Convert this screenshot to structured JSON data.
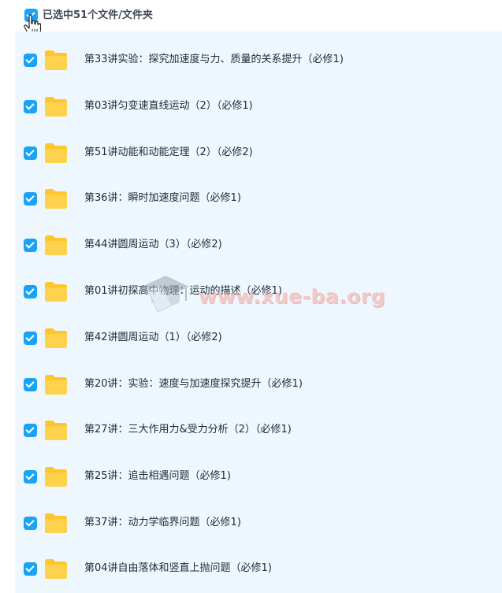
{
  "header": {
    "selection_label": "已选中51个文件/文件夹"
  },
  "items": [
    {
      "name": "第33讲实验：探究加速度与力、质量的关系提升（必修1)"
    },
    {
      "name": "第03讲匀变速直线运动（2）（必修1)"
    },
    {
      "name": "第51讲动能和动能定理（2）（必修2)"
    },
    {
      "name": "第36讲：瞬时加速度问题（必修1)"
    },
    {
      "name": "第44讲圆周运动（3）（必修2)"
    },
    {
      "name": "第01讲初探高中物理：运动的描述（必修1)"
    },
    {
      "name": "第42讲圆周运动（1）（必修2)"
    },
    {
      "name": "第20讲：实验：速度与加速度探究提升（必修1)"
    },
    {
      "name": "第27讲：三大作用力&受力分析（2）（必修1)"
    },
    {
      "name": "第25讲：追击相遇问题（必修1)"
    },
    {
      "name": "第37讲：动力学临界问题（必修1)"
    },
    {
      "name": "第04讲自由落体和竖直上抛问题（必修1)"
    }
  ],
  "watermark": {
    "text": "www.xue-ba.org"
  },
  "colors": {
    "checkbox": "#1aa3f5",
    "folder": "#ffc52b",
    "list_background": "#eef7fd"
  }
}
